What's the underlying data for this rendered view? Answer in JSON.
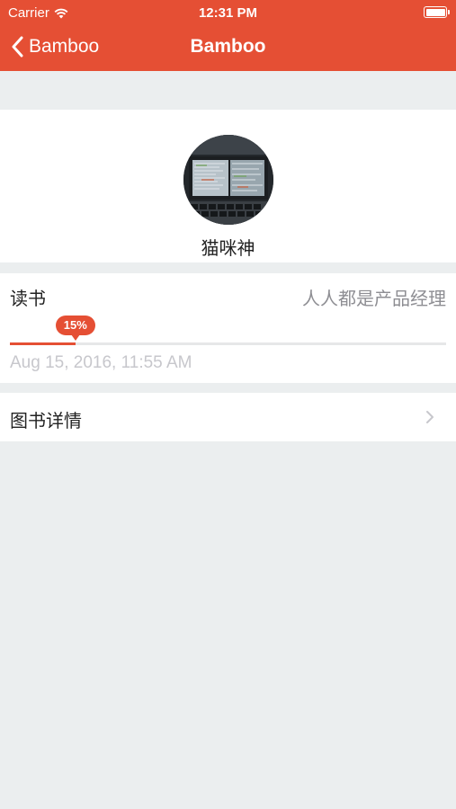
{
  "status_bar": {
    "carrier": "Carrier",
    "time": "12:31 PM"
  },
  "nav": {
    "back_label": "Bamboo",
    "title": "Bamboo"
  },
  "profile": {
    "name": "猫咪神"
  },
  "reading": {
    "title": "读书",
    "book_name": "人人都是产品经理",
    "progress_percent": 15,
    "progress_label": "15%",
    "date": "Aug 15, 2016, 11:55 AM"
  },
  "detail": {
    "label": "图书详情"
  },
  "colors": {
    "accent": "#e54f34",
    "background": "#ebeeef",
    "secondary_text": "#8e8e93"
  },
  "icons": {
    "wifi": "wifi-icon",
    "battery": "battery-icon",
    "back": "chevron-left-icon",
    "disclosure": "chevron-right-icon"
  }
}
